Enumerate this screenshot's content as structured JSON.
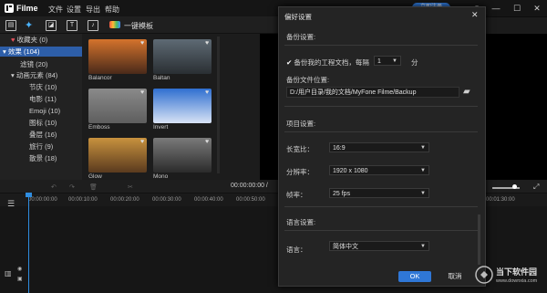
{
  "app": {
    "title": "Filme"
  },
  "menu": [
    "文件",
    "设置",
    "导出",
    "帮助"
  ],
  "header": {
    "register_label": "立即注册"
  },
  "toolbar": {
    "onekey_label": "一键模板"
  },
  "sidebar": {
    "items": [
      {
        "label": "收藏夹 (0)"
      },
      {
        "label": "效果 (104)"
      },
      {
        "label": "滤镜 (20)"
      },
      {
        "label": "动画元素 (84)"
      },
      {
        "label": "节庆 (10)"
      },
      {
        "label": "电影 (11)"
      },
      {
        "label": "Emoji (10)"
      },
      {
        "label": "图标 (10)"
      },
      {
        "label": "叠层 (16)"
      },
      {
        "label": "旅行 (9)"
      },
      {
        "label": "散景 (18)"
      }
    ]
  },
  "thumbs": [
    {
      "label": "Balancor",
      "color_a": "#d4732c",
      "color_b": "#4a2a1a"
    },
    {
      "label": "Baltan",
      "color_a": "#5e6a74",
      "color_b": "#2a2f33"
    },
    {
      "label": "Emboss",
      "color_a": "#8a8a8a",
      "color_b": "#5e5e5e"
    },
    {
      "label": "Invert",
      "color_a": "#2f6fd0",
      "color_b": "#d8e3f5"
    },
    {
      "label": "Glow",
      "color_a": "#c8923e",
      "color_b": "#5a3a1e"
    },
    {
      "label": "Mono",
      "color_a": "#7a7a7a",
      "color_b": "#2b2b2b"
    }
  ],
  "timeline": {
    "timecode": "00:00:00:00 /",
    "ticks": [
      "00:00:00:00",
      "00:00:10:00",
      "00:00:20:00",
      "00:00:30:00",
      "00:00:40:00",
      "00:00:50:00",
      "00:01:00:00",
      "00:01:10:00",
      "00:01:20:00",
      "00:01:30:00"
    ]
  },
  "dialog": {
    "title": "偏好设置",
    "backup_section": "备份设置:",
    "backup_checkbox": "备份我的工程文档，每隔",
    "backup_interval": "1",
    "backup_unit": "分",
    "backup_location_label": "备份文件位置:",
    "backup_path": "D:/用户目录/我的文档/MyFone Filme/Backup",
    "project_section": "项目设置:",
    "aspect_label": "长宽比：",
    "aspect_value": "16:9",
    "resolution_label": "分辨率：",
    "resolution_value": "1920 x 1080",
    "framerate_label": "帧率：",
    "framerate_value": "25 fps",
    "language_section": "语言设置:",
    "language_label": "语言：",
    "language_value": "简体中文",
    "ok_label": "OK",
    "cancel_label": "取消"
  },
  "watermark": {
    "line1": "当下软件园",
    "line2": "www.downxia.com"
  },
  "colors": {
    "accent": "#2f77d6",
    "selected": "#2d5ea8"
  }
}
